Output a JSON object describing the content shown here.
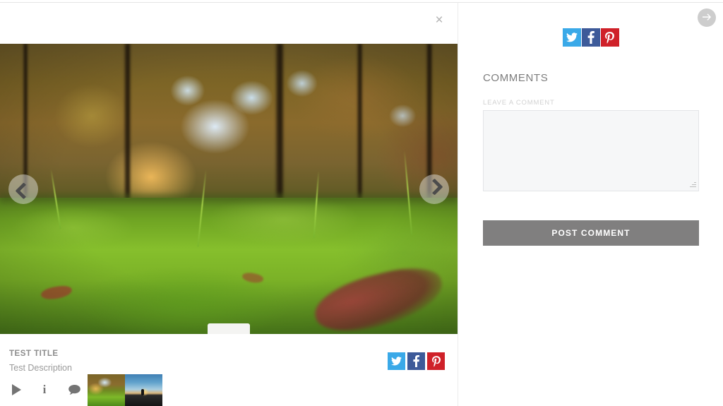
{
  "lightbox": {
    "close_label": "×",
    "prev_label": "Previous",
    "next_label": "Next",
    "collapse_label": "Collapse caption"
  },
  "caption": {
    "title": "TEST TITLE",
    "description": "Test Description"
  },
  "toolbar": {
    "play_label": "Play slideshow",
    "info_label": "i",
    "comment_label": "Comments"
  },
  "thumbnails": [
    {
      "name": "autumn-forest-moss",
      "active": true
    },
    {
      "name": "sunset-silhouette",
      "active": false
    }
  ],
  "share": {
    "twitter_label": "Twitter",
    "facebook_label": "Facebook",
    "pinterest_label": "Pinterest",
    "twitter_color": "#3aa9e8",
    "facebook_color": "#3d5a99",
    "pinterest_color": "#cf2129"
  },
  "comments_panel": {
    "next_label": "Next item",
    "heading": "COMMENTS",
    "field_label": "LEAVE A COMMENT",
    "textarea_value": "",
    "textarea_placeholder": "",
    "post_button": "POST COMMENT",
    "post_button_color": "#807f7f"
  }
}
